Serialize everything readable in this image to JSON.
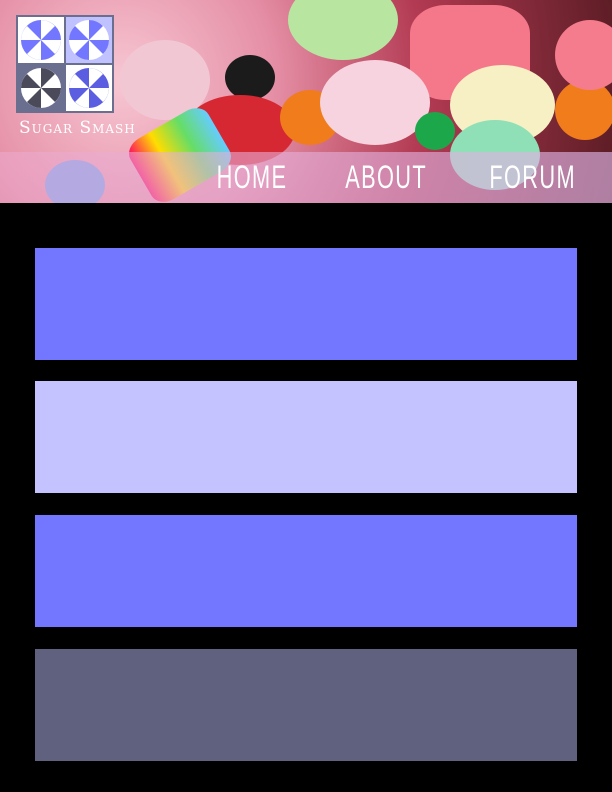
{
  "site": {
    "brand": "Sugar Smash"
  },
  "nav": {
    "items": [
      {
        "label": "HOME"
      },
      {
        "label": "ABOUT"
      },
      {
        "label": "FORUM"
      }
    ]
  },
  "logo": {
    "icon": "peppermint-swirl-icon",
    "tile_colors": [
      "#ffffff",
      "#bfc2ff",
      "#6b6f8f",
      "#ffffff"
    ]
  },
  "blocks": [
    {
      "color": "#7376ff"
    },
    {
      "color": "#c5c3ff"
    },
    {
      "color": "#7376ff"
    },
    {
      "color": "#60617f"
    }
  ],
  "colors": {
    "background": "#000000",
    "nav_overlay": "#e9acd4",
    "text": "#ffffff"
  }
}
